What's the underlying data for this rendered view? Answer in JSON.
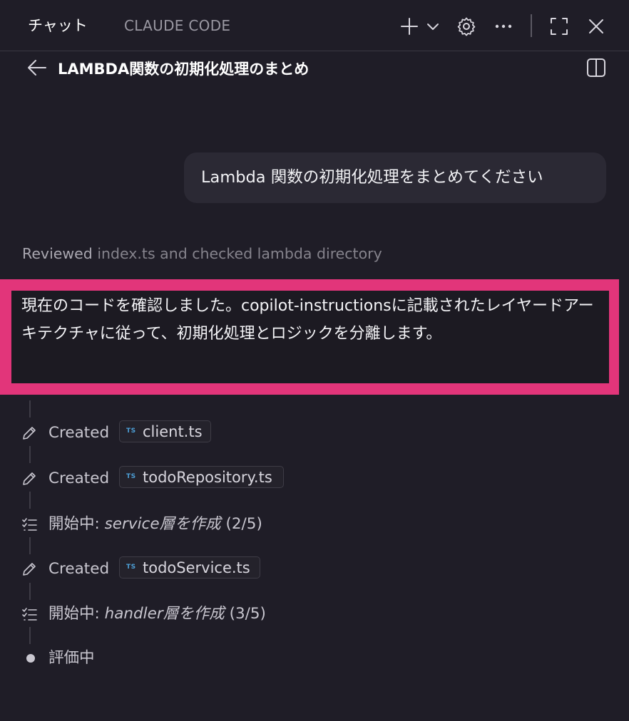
{
  "topbar": {
    "tab_chat": "チャット",
    "tab_claude_code": "CLAUDE CODE",
    "icons": [
      "plus-icon",
      "chevron-down-icon",
      "gear-icon",
      "ellipsis-icon",
      "fullscreen-icon",
      "close-icon"
    ]
  },
  "header": {
    "title": "LAMBDA関数の初期化処理のまとめ",
    "icons": [
      "back-arrow-icon",
      "split-panel-icon"
    ]
  },
  "conversation": {
    "user_message": "Lambda 関数の初期化処理をまとめてください",
    "reviewed_prefix": "Reviewed",
    "reviewed_detail": "index.ts and checked lambda directory",
    "assistant_message": "現在のコードを確認しました。copilot-instructionsに記載されたレイヤードアーキテクチャに従って、初期化処理とロジックを分離します。"
  },
  "steps": [
    {
      "kind": "created",
      "label": "Created",
      "file_badge": "TS",
      "file": "client.ts"
    },
    {
      "kind": "created",
      "label": "Created",
      "file_badge": "TS",
      "file": "todoRepository.ts"
    },
    {
      "kind": "task",
      "label": "開始中:",
      "task": "service層を作成",
      "progress": "(2/5)"
    },
    {
      "kind": "created",
      "label": "Created",
      "file_badge": "TS",
      "file": "todoService.ts"
    },
    {
      "kind": "task",
      "label": "開始中:",
      "task": "handler層を作成",
      "progress": "(3/5)"
    },
    {
      "kind": "status",
      "label": "評価中"
    }
  ],
  "colors": {
    "background": "#1f1d27",
    "highlight": "#e2357a",
    "bubble": "#2b2934",
    "ts_badge": "#4d9fd6"
  }
}
